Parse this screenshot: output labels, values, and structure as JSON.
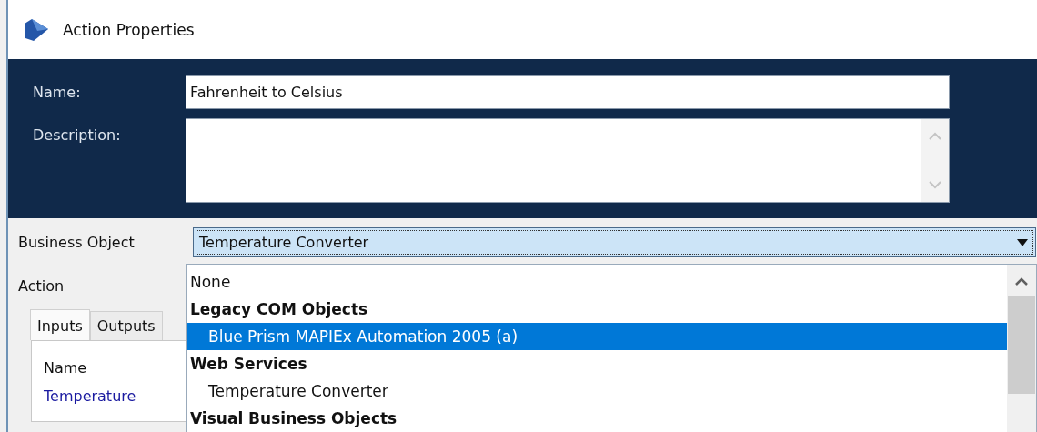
{
  "window": {
    "title": "Action Properties"
  },
  "header": {
    "fields": [
      {
        "label": "Name:",
        "kind": "text",
        "value": "Fahrenheit to Celsius"
      },
      {
        "label": "Description:",
        "kind": "multiline"
      }
    ]
  },
  "business_object": {
    "label": "Business Object",
    "value": "Temperature Converter",
    "expanded": true,
    "items": [
      {
        "text": "None",
        "kind": "option",
        "selected": false
      },
      {
        "text": "Legacy COM Objects",
        "kind": "group",
        "selected": false,
        "children": [
          {
            "text": "Blue Prism MAPIEx Automation 2005 (a)",
            "kind": "option",
            "selected": true
          }
        ]
      },
      {
        "text": "Web Services",
        "kind": "group",
        "selected": false,
        "children": [
          {
            "text": "Temperature Converter",
            "kind": "option",
            "selected": false
          }
        ]
      },
      {
        "text": "Visual Business Objects",
        "kind": "group",
        "selected": false
      }
    ]
  },
  "action": {
    "label": "Action"
  },
  "tabs": [
    {
      "label": "Inputs",
      "selected": true
    },
    {
      "label": "Outputs",
      "selected": false
    }
  ],
  "inputs_table": {
    "columns": [
      "Name"
    ],
    "rows": [
      [
        "Temperature"
      ]
    ]
  }
}
